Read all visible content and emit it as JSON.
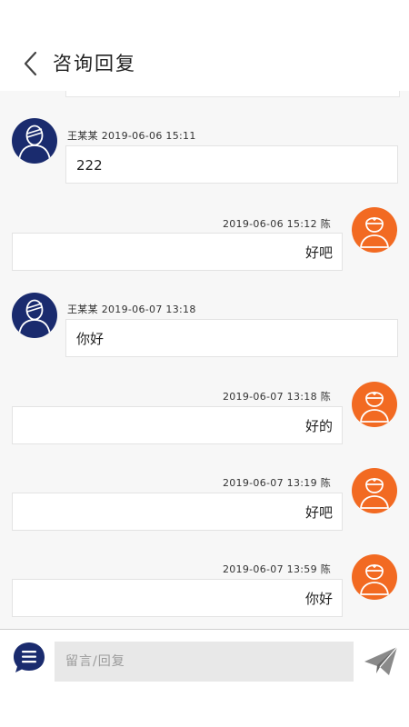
{
  "header": {
    "title": "咨询回复",
    "back_icon": "chevron-left-icon"
  },
  "messages": [
    {
      "side": "left",
      "sender": "王某某",
      "time": "2019-06-06 15:11",
      "text": "222"
    },
    {
      "side": "right",
      "sender": "陈",
      "time": "2019-06-06 15:12",
      "text": "好吧"
    },
    {
      "side": "left",
      "sender": "王某某",
      "time": "2019-06-07 13:18",
      "text": "你好"
    },
    {
      "side": "right",
      "sender": "陈",
      "time": "2019-06-07 13:18",
      "text": "好的"
    },
    {
      "side": "right",
      "sender": "陈",
      "time": "2019-06-07 13:19",
      "text": "好吧"
    },
    {
      "side": "right",
      "sender": "陈",
      "time": "2019-06-07 13:59",
      "text": "你好"
    }
  ],
  "composer": {
    "placeholder": "留言/回复",
    "menu_icon": "chat-menu-icon",
    "send_icon": "paper-plane-icon"
  },
  "colors": {
    "user_avatar": "#1a2b6e",
    "doctor_avatar": "#f26a22",
    "chat_background": "#f7f7f7"
  }
}
